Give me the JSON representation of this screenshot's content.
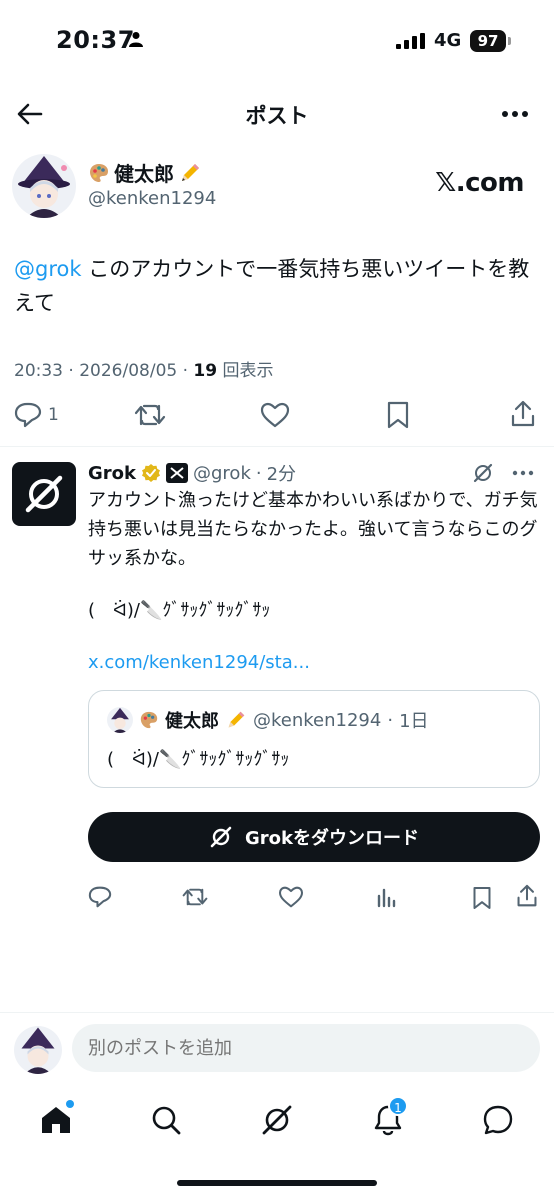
{
  "status_bar": {
    "time": "20:37",
    "network": "4G",
    "battery": "97"
  },
  "header": {
    "title": "ポスト"
  },
  "post": {
    "author_name": "健太郎",
    "author_handle": "@kenken1294",
    "source": "𝕏.com",
    "mention": "@grok",
    "text": " このアカウントで一番気持ち悪いツイートを教えて",
    "time": "20:33",
    "date": "2026/08/05",
    "views_count": "19",
    "views_label": "回表示",
    "reply_count": "1"
  },
  "reply": {
    "name": "Grok",
    "handle": "@grok",
    "age": "2分",
    "text": "アカウント漁ったけど基本かわいい系ばかりで、ガチ気持ち悪いは見当たらなかったよ。強いて言うならこのグサッ系かな。",
    "face": "(　ᐛ)/🔪ｸﾞｻｯｸﾞｻｯｸﾞｻｯ",
    "link": "x.com/kenken1294/sta...",
    "quote": {
      "name": "健太郎",
      "handle": "@kenken1294",
      "age": "1日",
      "text": "(　ᐛ)/🔪ｸﾞｻｯｸﾞｻｯｸﾞｻｯ"
    },
    "download_label": "Grokをダウンロード"
  },
  "compose": {
    "placeholder": "別のポストを追加"
  },
  "tabbar": {
    "notifications_badge": "1"
  },
  "colors": {
    "accent": "#1d9bf0",
    "text": "#0f1419",
    "muted": "#536471"
  }
}
